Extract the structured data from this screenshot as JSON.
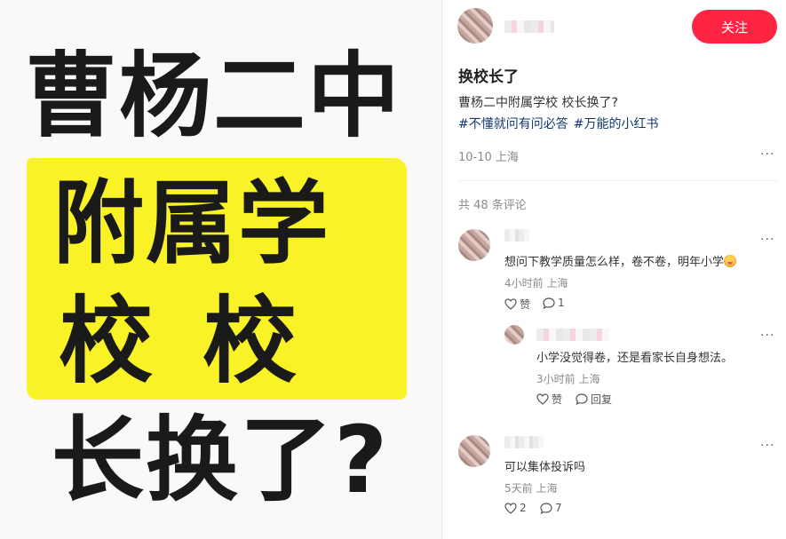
{
  "poster": {
    "line1": "曹杨二中",
    "line2": "附属学",
    "line3a": "校",
    "line3b": "校",
    "line4": "长换了?"
  },
  "post": {
    "follow_label": "关注",
    "title": "换校长了",
    "body": "曹杨二中附属学校 校长换了?",
    "tags": [
      "#不懂就问有问必答",
      "#万能的小红书"
    ],
    "meta": "10-10 上海",
    "more": "···"
  },
  "comments_header": "共 48 条评论",
  "comments": [
    {
      "text": "想问下教学质量怎么样，卷不卷，明年小学",
      "meta": "4小时前 上海",
      "likes_label": "赞",
      "replies_count": "1",
      "more": "···"
    },
    {
      "text": "小学没觉得卷，还是看家长自身想法。",
      "meta": "3小时前 上海",
      "likes_label": "赞",
      "reply_label": "回复",
      "more": "···"
    },
    {
      "text": "可以集体投诉吗",
      "meta": "5天前 上海",
      "likes_count": "2",
      "replies_count": "7",
      "more": "···"
    }
  ],
  "colors": {
    "accent": "#ff2442",
    "tag": "#13386c",
    "highlight": "#f8f227"
  },
  "icons": [
    "heart-icon",
    "comment-bubble-icon",
    "more-icon",
    "emoji-icon"
  ]
}
